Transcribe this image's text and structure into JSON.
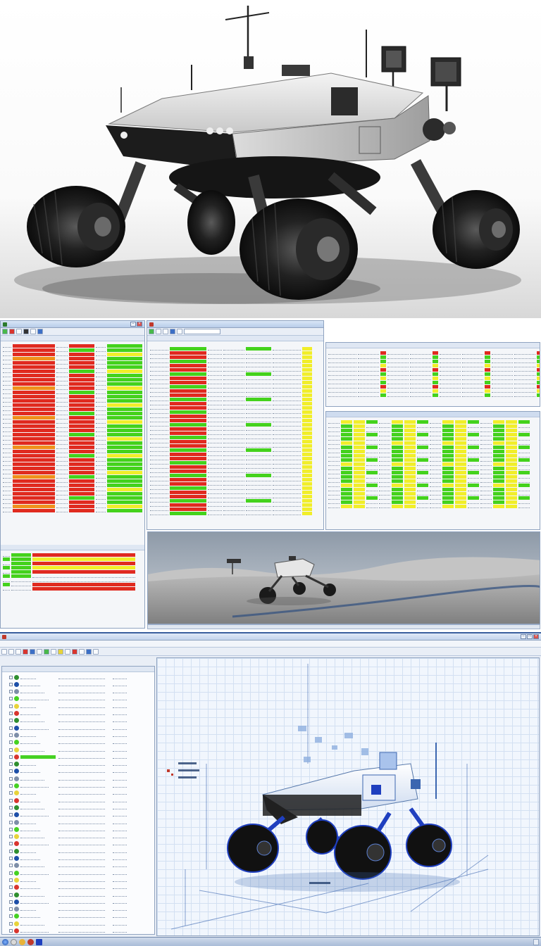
{
  "colors": {
    "status_fail": "#e02a1f",
    "status_ok": "#44d21c",
    "status_warn": "#f1ee2a",
    "chrome_blue": "#b8cde9",
    "accent": "#3a5f9e"
  },
  "icons": [
    "antenna-icon",
    "gear-icon",
    "close-icon",
    "minimize-icon",
    "maximize-icon",
    "folder-icon",
    "play-icon",
    "stop-icon"
  ],
  "windows": {
    "left_monitor": {
      "title": "",
      "toolbar": []
    },
    "center_table": {
      "title": "",
      "dropdown": ""
    },
    "right_top": {
      "title": ""
    },
    "right_bottom": {
      "title": ""
    },
    "desert_view": {
      "title": ""
    }
  },
  "cad_app": {
    "menu": [
      "",
      "",
      "",
      "",
      "",
      ""
    ],
    "viewport_labels": [
      "",
      ""
    ],
    "tree_highlight": ""
  },
  "taskbar": {
    "tray": ""
  }
}
